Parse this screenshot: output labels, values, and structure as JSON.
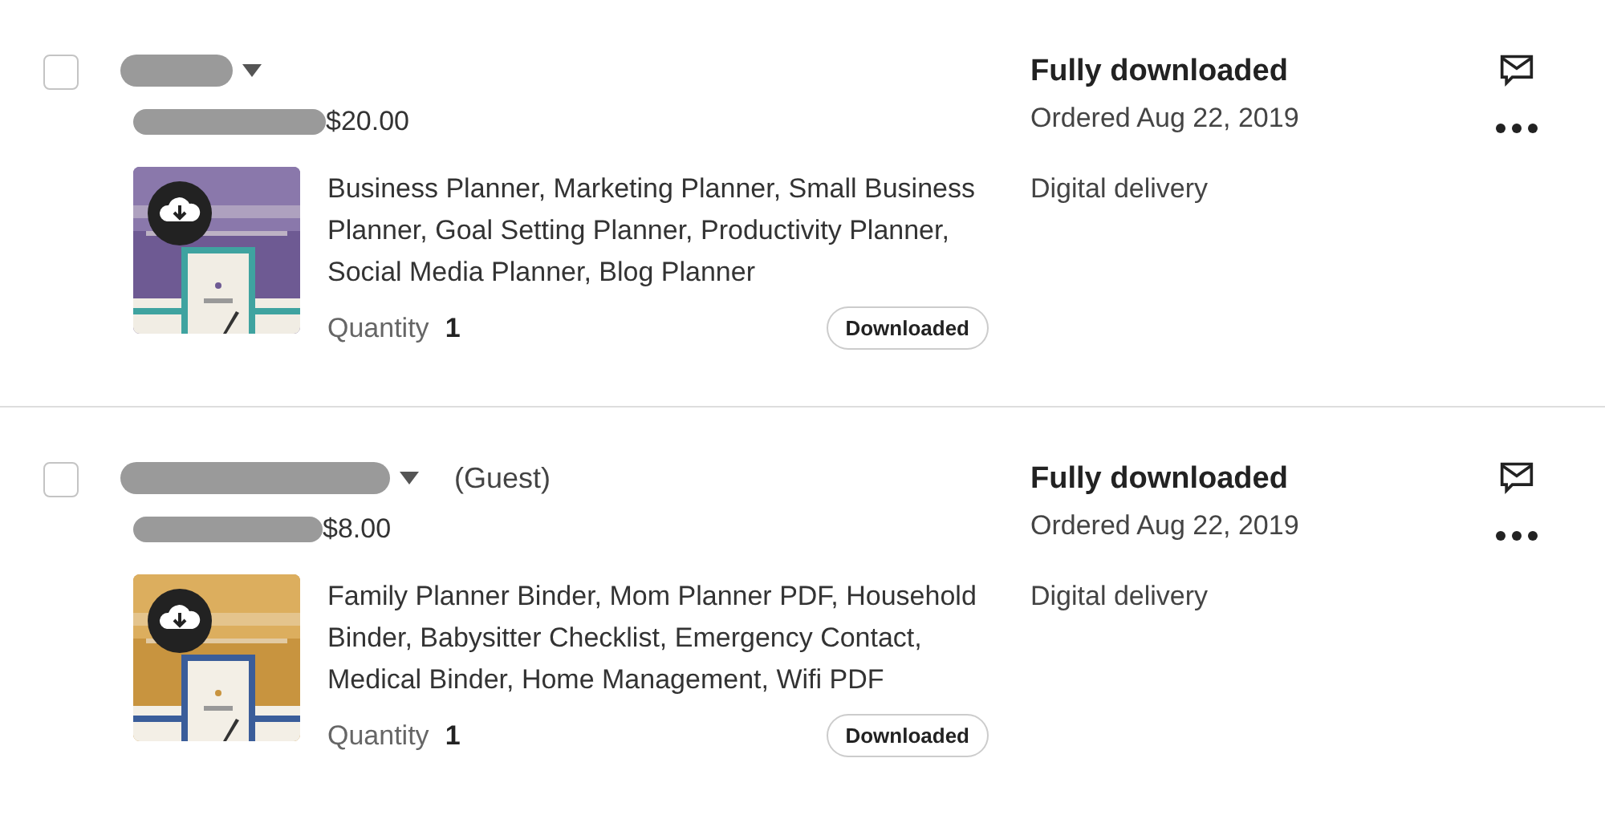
{
  "orders": [
    {
      "checked": false,
      "buyer_redacted": true,
      "price": "$20.00",
      "price_prefix_redacted": true,
      "description": "Business Planner, Marketing Planner, Small Business Planner, Goal Setting Planner, Productivity Planner, Social Media Planner, Blog Planner",
      "quantity_label": "Quantity",
      "quantity": "1",
      "badge": "Downloaded",
      "status": "Fully downloaded",
      "ordered": "Ordered Aug 22, 2019",
      "delivery": "Digital delivery"
    },
    {
      "checked": false,
      "buyer_redacted": true,
      "guest_label": "(Guest)",
      "price": "$8.00",
      "price_prefix_redacted": true,
      "description": "Family Planner Binder, Mom Planner PDF, Household Binder, Babysitter Checklist, Emergency Contact, Medical Binder, Home Management, Wifi PDF",
      "quantity_label": "Quantity",
      "quantity": "1",
      "badge": "Downloaded",
      "status": "Fully downloaded",
      "ordered": "Ordered Aug 22, 2019",
      "delivery": "Digital delivery"
    }
  ]
}
